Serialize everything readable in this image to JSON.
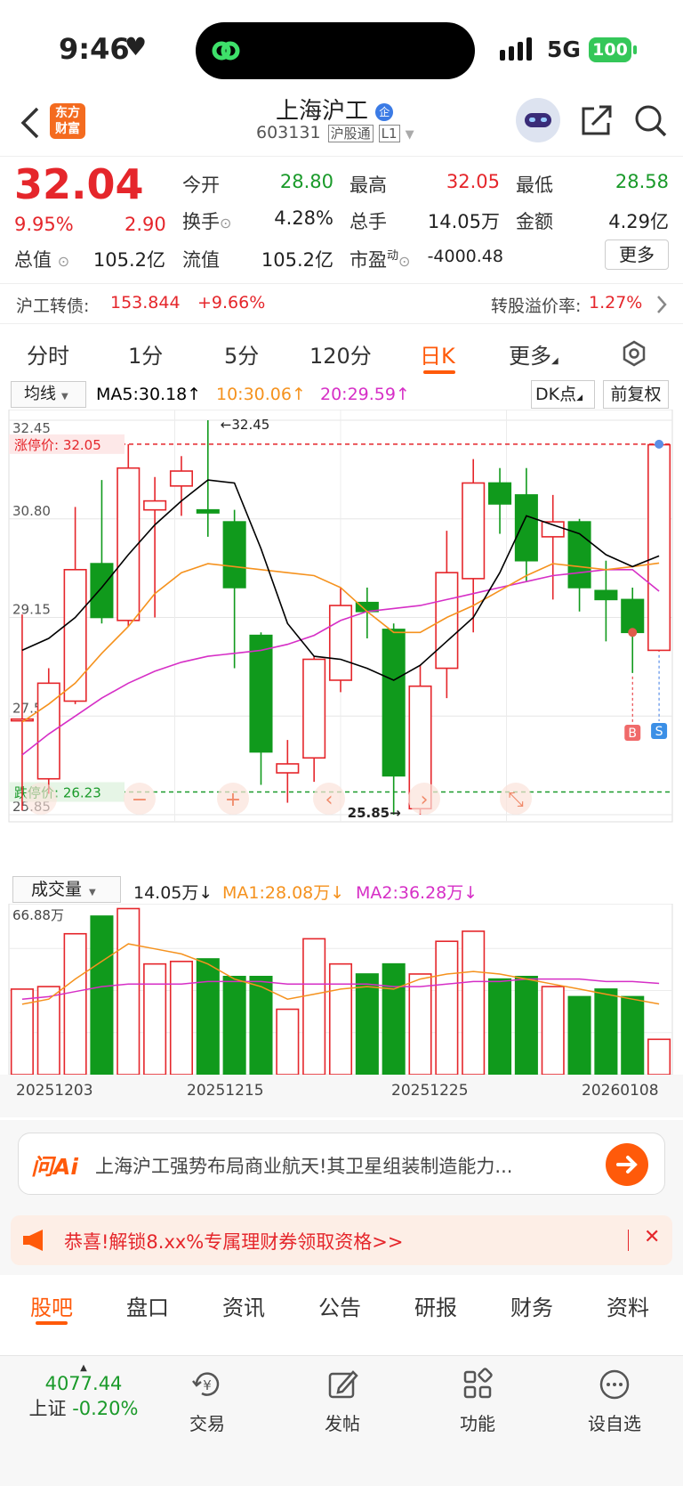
{
  "status": {
    "time": "9:46",
    "network": "5G",
    "battery": "100"
  },
  "header": {
    "title": "上海沪工",
    "code": "603131",
    "badge1": "沪股通",
    "badge2": "L1",
    "logo_line1": "东方",
    "logo_line2": "财富",
    "tag": "企"
  },
  "quote": {
    "price": "32.04",
    "change_pct": "9.95%",
    "change": "2.90",
    "labels": {
      "open": "今开",
      "high": "最高",
      "low": "最低",
      "turnover": "换手",
      "volume": "总手",
      "amount": "金额",
      "mcap": "总值",
      "float": "流值",
      "pe": "市盈",
      "pe_sup": "动"
    },
    "open": "28.80",
    "high": "32.05",
    "low": "28.58",
    "turnover": "4.28%",
    "volume": "14.05万",
    "amount": "4.29亿",
    "mcap": "105.2亿",
    "float": "105.2亿",
    "pe": "-4000.48",
    "more": "更多"
  },
  "bond": {
    "label": "沪工转债:",
    "price": "153.844",
    "pct": "+9.66%",
    "premium_label": "转股溢价率:",
    "premium": "1.27%"
  },
  "tabs": [
    "分时",
    "1分",
    "5分",
    "120分",
    "日K",
    "更多"
  ],
  "ma_bar": {
    "selector": "均线",
    "ma5": "MA5:30.18",
    "ma10": "10:30.06",
    "ma20": "20:29.59",
    "dk": "DK点",
    "adj": "前复权"
  },
  "vol_bar": {
    "selector": "成交量",
    "vol": "14.05万",
    "ma1": "MA1:28.08万",
    "ma2": "MA2:36.28万"
  },
  "chart_labels": {
    "limit_up": "涨停价: 32.05",
    "limit_down": "跌停价: 26.23",
    "y_ticks": [
      "32.45",
      "30.80",
      "29.15",
      "27.50",
      "25.85"
    ],
    "max_label": "←32.45",
    "min_label": "25.85→",
    "vol_max": "66.88万",
    "dates": [
      "20251203",
      "20251215",
      "20251225",
      "20260108"
    ],
    "b": "B",
    "s": "S"
  },
  "colors": {
    "up": "#e5262b",
    "down": "#109a1c",
    "ma5": "#000000",
    "ma10": "#f5921e",
    "ma20": "#d62fc6",
    "accent": "#ff5a0a"
  },
  "chart_data": {
    "type": "candlestick",
    "ylim": [
      25.85,
      32.45
    ],
    "candles": [
      [
        27.45,
        27.45,
        29.2,
        25.92
      ],
      [
        26.45,
        28.05,
        28.3,
        26.2
      ],
      [
        27.75,
        29.95,
        31.0,
        27.7
      ],
      [
        30.05,
        29.15,
        31.45,
        29.05
      ],
      [
        29.1,
        31.65,
        32.05,
        29.0
      ],
      [
        30.95,
        31.1,
        31.5,
        29.15
      ],
      [
        31.35,
        31.6,
        31.85,
        30.85
      ],
      [
        30.95,
        30.9,
        32.45,
        30.5
      ],
      [
        30.75,
        29.65,
        30.95,
        28.3
      ],
      [
        28.85,
        26.9,
        28.9,
        26.35
      ],
      [
        26.55,
        26.7,
        27.1,
        26.05
      ],
      [
        26.8,
        28.45,
        28.5,
        26.4
      ],
      [
        28.1,
        29.35,
        29.65,
        27.9
      ],
      [
        29.4,
        29.25,
        29.65,
        28.8
      ],
      [
        28.95,
        26.5,
        29.05,
        25.85
      ],
      [
        25.95,
        28.0,
        28.35,
        25.85
      ],
      [
        28.3,
        29.9,
        30.6,
        27.8
      ],
      [
        29.8,
        31.4,
        31.8,
        28.9
      ],
      [
        31.4,
        31.05,
        31.65,
        30.55
      ],
      [
        31.2,
        30.1,
        31.65,
        29.75
      ],
      [
        30.5,
        30.75,
        31.2,
        29.45
      ],
      [
        30.75,
        29.65,
        30.8,
        29.25
      ],
      [
        29.6,
        29.45,
        30.1,
        28.75
      ],
      [
        29.45,
        28.9,
        29.65,
        28.22
      ],
      [
        28.6,
        32.04,
        32.05,
        28.58
      ]
    ],
    "ma5": [
      28.6,
      28.8,
      29.15,
      29.65,
      30.2,
      30.7,
      31.1,
      31.45,
      31.4,
      30.3,
      29.05,
      28.5,
      28.45,
      28.3,
      28.1,
      28.35,
      28.75,
      29.15,
      29.9,
      30.85,
      30.7,
      30.55,
      30.2,
      30.0,
      30.18
    ],
    "ma10": [
      27.4,
      27.7,
      28.05,
      28.55,
      29.0,
      29.55,
      29.9,
      30.05,
      30.0,
      29.95,
      29.9,
      29.85,
      29.65,
      29.25,
      28.9,
      28.9,
      29.15,
      29.35,
      29.6,
      29.85,
      30.05,
      30.0,
      29.95,
      30.0,
      30.06
    ],
    "ma20": [
      26.85,
      27.2,
      27.5,
      27.8,
      28.05,
      28.25,
      28.4,
      28.5,
      28.55,
      28.6,
      28.7,
      28.85,
      29.1,
      29.25,
      29.3,
      29.35,
      29.45,
      29.55,
      29.65,
      29.75,
      29.85,
      29.9,
      29.95,
      29.95,
      29.59
    ],
    "volume": [
      34,
      35,
      56,
      63,
      66,
      44,
      45,
      46,
      39,
      39,
      26,
      54,
      44,
      40,
      44,
      40,
      53,
      57,
      38,
      39,
      35,
      31,
      34,
      31,
      14.05
    ],
    "vol_ma1": [
      28,
      30,
      38,
      45,
      52,
      50,
      48,
      44,
      38,
      35,
      30,
      32,
      34,
      35,
      34,
      38,
      40,
      41,
      40,
      38,
      36,
      34,
      32,
      30,
      28.08
    ],
    "vol_ma2": [
      30,
      31,
      33,
      35,
      36,
      36,
      36,
      37,
      37,
      37,
      36,
      36,
      36,
      36,
      35,
      35,
      36,
      37,
      37,
      38,
      38,
      38,
      37,
      37,
      36.28
    ],
    "vol_ylim": [
      0,
      66.88
    ]
  },
  "ai_bar": {
    "logo": "问Ai",
    "text": "上海沪工强势布局商业航天!其卫星组装制造能力..."
  },
  "promo": {
    "text": "恭喜!解锁8.xx%专属理财券领取资格>>"
  },
  "bottom_tabs": [
    "股吧",
    "盘口",
    "资讯",
    "公告",
    "研报",
    "财务",
    "资料"
  ],
  "nav": {
    "index_value": "4077.44",
    "index_name": "上证",
    "index_pct": "-0.20%",
    "trade": "交易",
    "post": "发帖",
    "func": "功能",
    "watch": "设自选"
  }
}
